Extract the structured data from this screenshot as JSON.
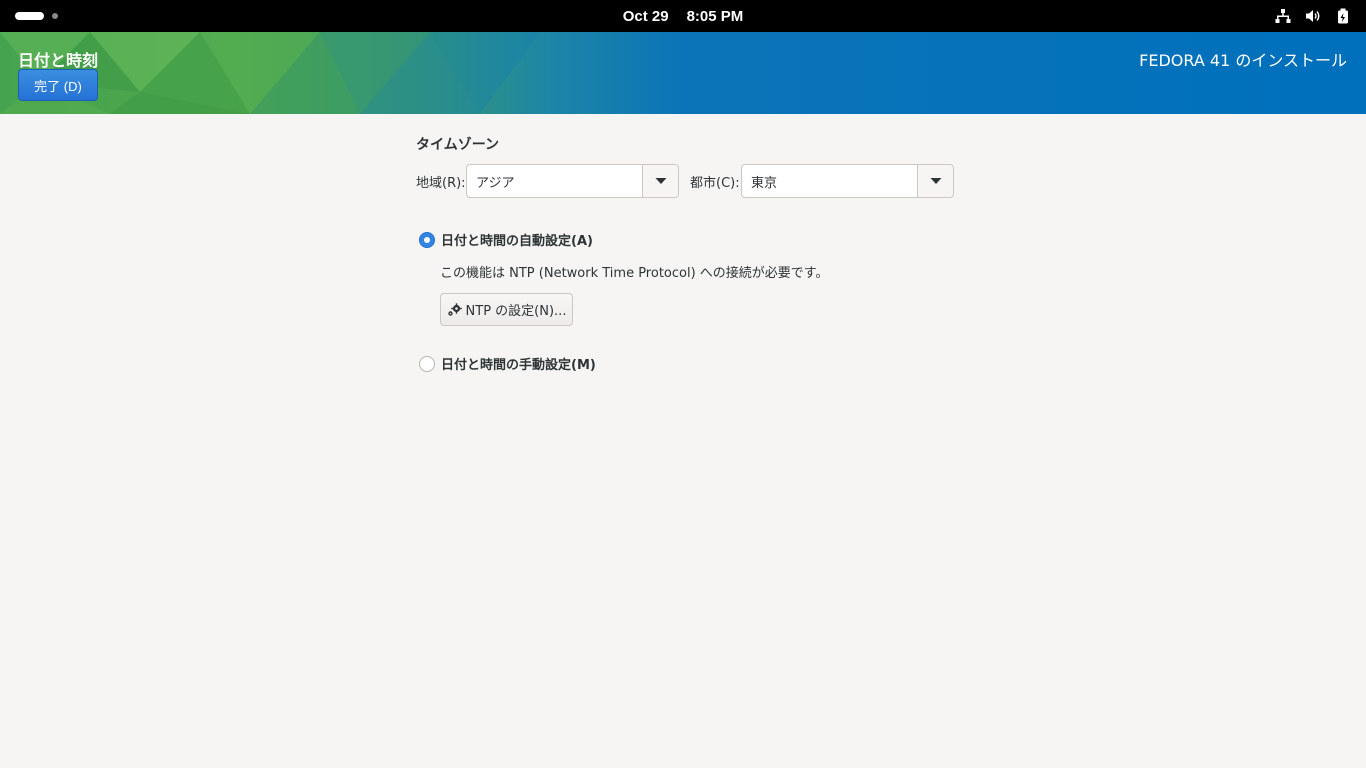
{
  "topbar": {
    "date": "Oct 29",
    "time": "8:05 PM",
    "icons": [
      "network-icon",
      "volume-icon",
      "battery-icon"
    ]
  },
  "header": {
    "page_title": "日付と時刻",
    "done_button": "完了 (D)",
    "product_title": "FEDORA 41 のインストール"
  },
  "timezone": {
    "heading": "タイムゾーン",
    "region_label": "地域(R):",
    "region_value": "アジア",
    "city_label": "都市(C):",
    "city_value": "東京"
  },
  "auto": {
    "label": "日付と時間の自動設定(A)",
    "selected": true,
    "description": "この機能は NTP (Network Time Protocol) への接続が必要です。",
    "ntp_button": "NTP の設定(N)..."
  },
  "manual": {
    "label": "日付と時間の手動設定(M)",
    "selected": false
  },
  "colors": {
    "accent": "#3584e4",
    "banner_blue": "#0070bc",
    "banner_green": "#4fa84a",
    "background": "#f6f5f4"
  }
}
